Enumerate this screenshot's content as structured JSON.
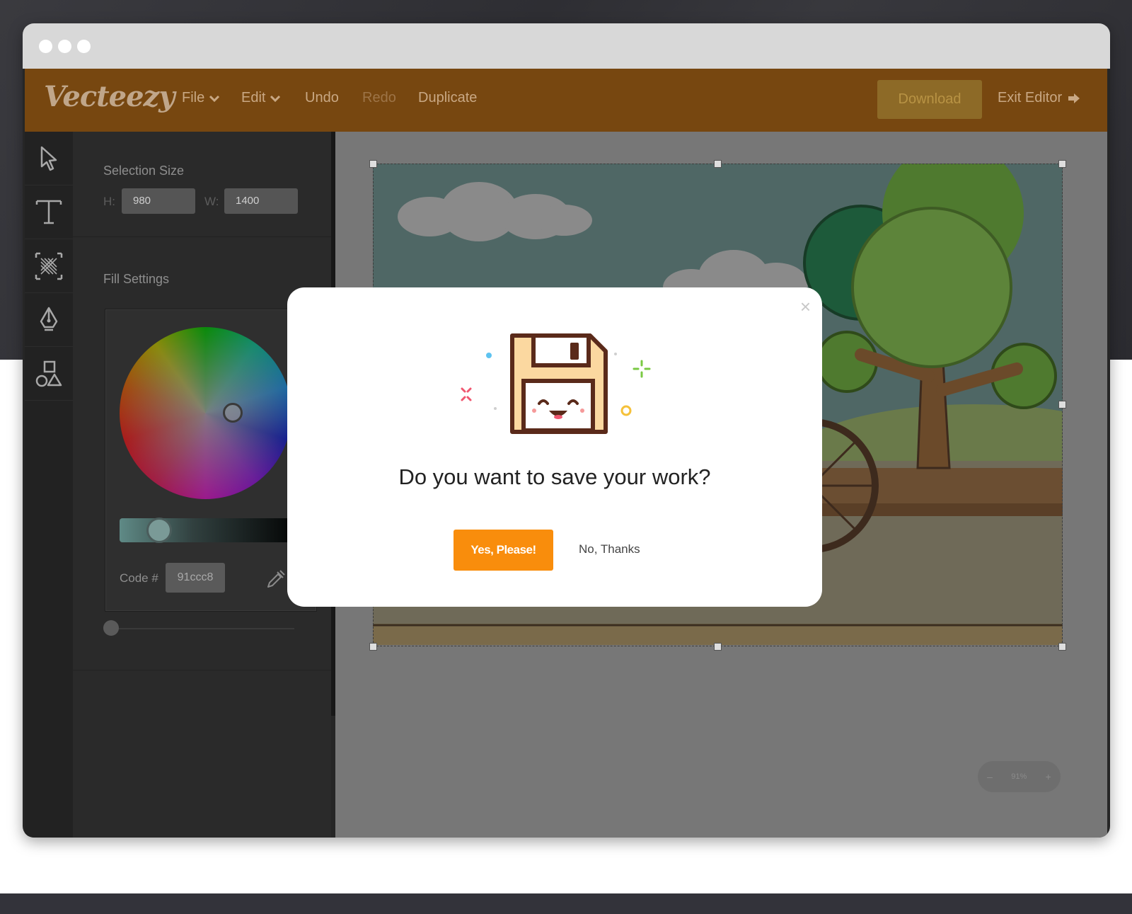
{
  "app": {
    "logo": "Vecteezy"
  },
  "menu": {
    "file": "File",
    "edit": "Edit",
    "undo": "Undo",
    "redo": "Redo",
    "duplicate": "Duplicate",
    "download": "Download",
    "exit_editor": "Exit Editor"
  },
  "tools": [
    {
      "icon": "select-arrow-icon"
    },
    {
      "icon": "text-tool-icon"
    },
    {
      "icon": "pattern-tool-icon"
    },
    {
      "icon": "pen-tool-icon"
    },
    {
      "icon": "shapes-tool-icon"
    }
  ],
  "panel": {
    "selection_size_title": "Selection Size",
    "height_label": "H:",
    "height_value": "980",
    "width_label": "W:",
    "width_value": "1400",
    "fill_settings_title": "Fill Settings",
    "code_label": "Code #",
    "code_value": "91ccc8"
  },
  "canvas": {
    "zoom_minus": "–",
    "zoom_value": "91%",
    "zoom_plus": "+"
  },
  "modal": {
    "close": "×",
    "title": "Do you want to save your work?",
    "yes_label": "Yes, Please!",
    "no_label": "No, Thanks"
  },
  "colors": {
    "topbar": "#774710",
    "accent_button": "#f98d0c"
  }
}
